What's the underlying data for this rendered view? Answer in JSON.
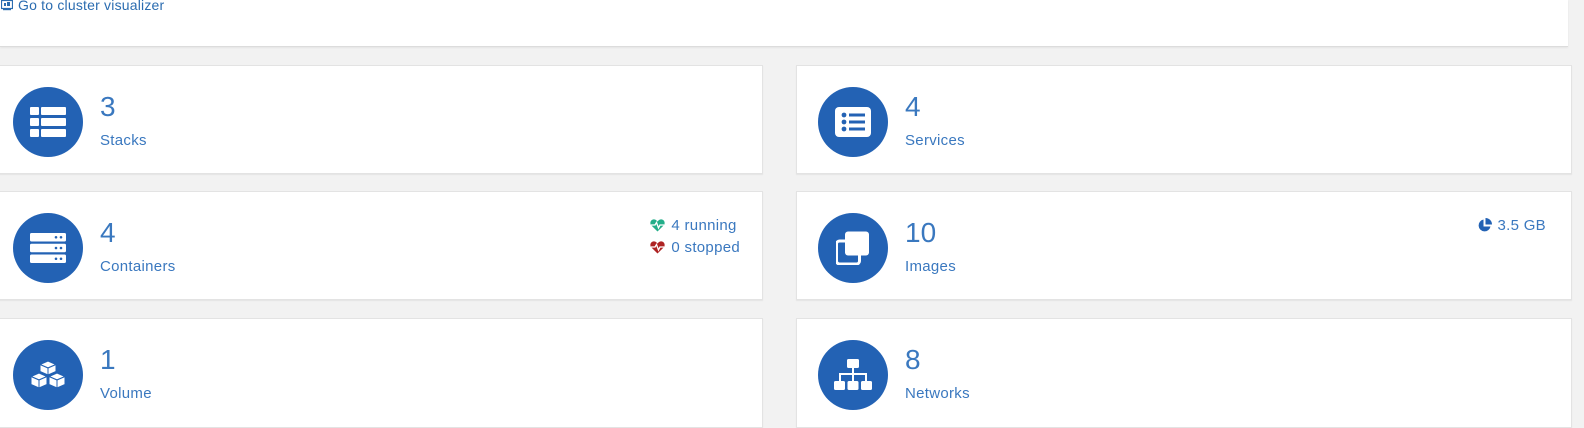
{
  "top": {
    "link_label": "Go to cluster visualizer"
  },
  "cards": {
    "stacks": {
      "count": "3",
      "label": "Stacks",
      "icon": "th-list-icon"
    },
    "services": {
      "count": "4",
      "label": "Services",
      "icon": "list-alt-icon"
    },
    "containers": {
      "count": "4",
      "label": "Containers",
      "icon": "server-icon",
      "running": "4 running",
      "stopped": "0 stopped"
    },
    "images": {
      "count": "10",
      "label": "Images",
      "icon": "clone-icon",
      "size": "3.5 GB"
    },
    "volumes": {
      "count": "1",
      "label": "Volume",
      "icon": "cubes-icon"
    },
    "networks": {
      "count": "8",
      "label": "Networks",
      "icon": "sitemap-icon"
    }
  },
  "colors": {
    "accent": "#2362b4",
    "text": "#3a78bf",
    "running": "#23ae89",
    "stopped": "#ae2323"
  }
}
